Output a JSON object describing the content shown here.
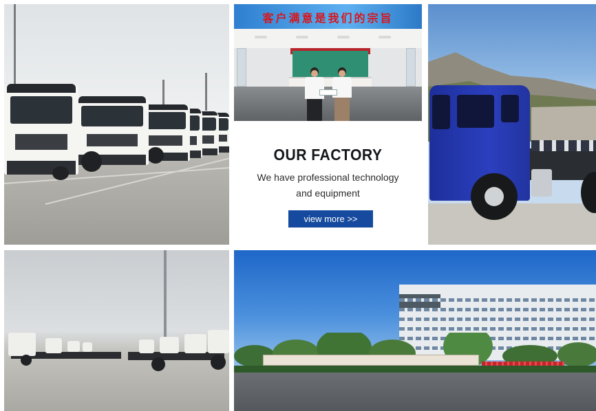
{
  "banner_slogan": "客户满意是我们的宗旨",
  "card": {
    "title": "OUR FACTORY",
    "line1": "We have professional technology",
    "line2": "and equipment",
    "button_label": "view more >>"
  },
  "colors": {
    "button_bg": "#154a9e",
    "button_text": "#ffffff",
    "title_text": "#15171a",
    "truck_blue": "#2b3fbf"
  }
}
